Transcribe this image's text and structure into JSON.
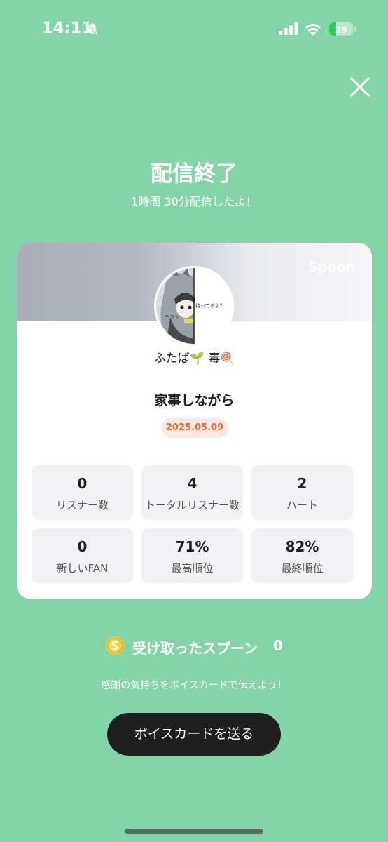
{
  "status_bar": {
    "time": "14:11",
    "battery_percent": "29",
    "battery_level": 0.29,
    "icons": [
      "bell-slash-icon",
      "signal-icon",
      "wifi-icon",
      "battery-charging-icon"
    ]
  },
  "header": {
    "close_icon": "close-icon",
    "title": "配信終了",
    "subtitle": "1時間 30分配信したよ！"
  },
  "card": {
    "banner_watermark": "Spoon",
    "avatar_texts": [
      "待ってるよ？",
      "チラッ"
    ],
    "username": "ふたば🌱 毒🍭",
    "show_title": "家事しながら",
    "date": "2025.05.09",
    "stats": [
      {
        "value": "0",
        "label": "リスナー数"
      },
      {
        "value": "4",
        "label": "トータルリスナー数"
      },
      {
        "value": "2",
        "label": "ハート"
      },
      {
        "value": "0",
        "label": "新しいFAN"
      },
      {
        "value": "71%",
        "label": "最高順位"
      },
      {
        "value": "82%",
        "label": "最終順位"
      }
    ]
  },
  "spoons": {
    "icon": "spoon-coin-icon",
    "label": "受け取ったスプーン",
    "count": "0"
  },
  "thanks_message": "感謝の気持ちをボイスカードで伝えよう！",
  "voice_card_button": "ボイスカードを送る",
  "colors": {
    "background": "#83d4a8",
    "card": "#ffffff",
    "stat_tile": "#f2f2f4",
    "date_badge_bg": "#fde8e2",
    "date_badge_text": "#ea6a2e",
    "button": "#1f1f1f",
    "battery_charging": "#34c759"
  }
}
